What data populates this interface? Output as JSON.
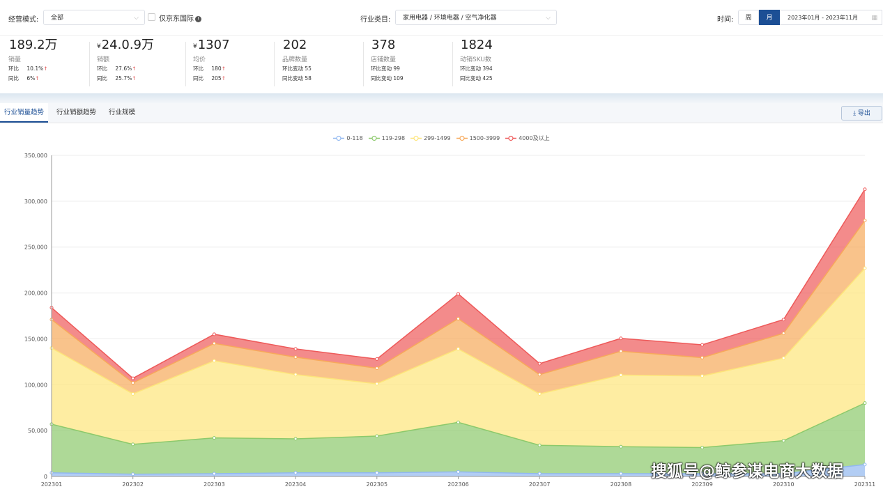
{
  "filters": {
    "mode_label": "经营模式:",
    "mode_value": "全部",
    "jd_intl_label": "仅京东国际",
    "category_label": "行业类目:",
    "category_value": "家用电器 / 环境电器 / 空气净化器",
    "time_label": "时间:",
    "week_label": "周",
    "month_label": "月",
    "date_range": "2023年01月 - 2023年11月"
  },
  "metrics": [
    {
      "value": "189.2万",
      "currency": "",
      "name": "销量",
      "r1k": "环比",
      "r1v": "10.1%",
      "r1up": "↑",
      "r2k": "同比",
      "r2v": "6%",
      "r2up": "↑"
    },
    {
      "value": "24.0.9万",
      "currency": "¥",
      "name": "销额",
      "r1k": "环比",
      "r1v": "27.6%",
      "r1up": "↑",
      "r2k": "同比",
      "r2v": "25.7%",
      "r2up": "↑"
    },
    {
      "value": "1307",
      "currency": "¥",
      "name": "均价",
      "r1k": "环比",
      "r1v": "180",
      "r1up": "↑",
      "r2k": "同比",
      "r2v": "205",
      "r2up": "↑"
    },
    {
      "value": "202",
      "currency": "",
      "name": "品牌数量",
      "r1k": "环比变动",
      "r1v": "55",
      "r1up": "",
      "r2k": "同比变动",
      "r2v": "58",
      "r2up": ""
    },
    {
      "value": "378",
      "currency": "",
      "name": "店铺数量",
      "r1k": "环比变动",
      "r1v": "99",
      "r1up": "",
      "r2k": "同比变动",
      "r2v": "109",
      "r2up": ""
    },
    {
      "value": "1824",
      "currency": "",
      "name": "动销SKU数",
      "r1k": "环比变动",
      "r1v": "394",
      "r1up": "",
      "r2k": "同比变动",
      "r2v": "425",
      "r2up": ""
    }
  ],
  "tabs": [
    "行业销量趋势",
    "行业销额趋势",
    "行业规模"
  ],
  "export_label": "导出",
  "watermark": "搜狐号@鲸参谋电商大数据",
  "chart_data": {
    "type": "area",
    "stacked": true,
    "categories": [
      "202301",
      "202302",
      "202303",
      "202304",
      "202305",
      "202306",
      "202307",
      "202308",
      "202309",
      "202310",
      "202311"
    ],
    "ylim": [
      0,
      350000
    ],
    "yticks": [
      "0",
      "50,000",
      "100,000",
      "150,000",
      "200,000",
      "250,000",
      "300,000",
      "350,000"
    ],
    "grid": true,
    "legend_position": "top-center",
    "series": [
      {
        "name": "0-118",
        "color": "#91b8f0",
        "values": [
          4000,
          2500,
          3000,
          4000,
          4000,
          5000,
          3000,
          3000,
          3000,
          3000,
          13000
        ]
      },
      {
        "name": "119-298",
        "color": "#8cc96b",
        "values": [
          53000,
          32500,
          39000,
          37000,
          40000,
          54000,
          31000,
          29500,
          28500,
          36000,
          67000
        ]
      },
      {
        "name": "299-1499",
        "color": "#fde57a",
        "values": [
          83000,
          55000,
          84000,
          70000,
          57000,
          80000,
          56000,
          78000,
          78000,
          90000,
          147000
        ]
      },
      {
        "name": "1500-3999",
        "color": "#f7a95a",
        "values": [
          31000,
          12000,
          19000,
          19000,
          17000,
          33000,
          21000,
          26000,
          20000,
          27000,
          52000
        ]
      },
      {
        "name": "4000及以上",
        "color": "#ee5a5a",
        "values": [
          13000,
          5000,
          10000,
          9000,
          10000,
          27000,
          12000,
          14000,
          14000,
          15000,
          34000
        ]
      }
    ]
  }
}
